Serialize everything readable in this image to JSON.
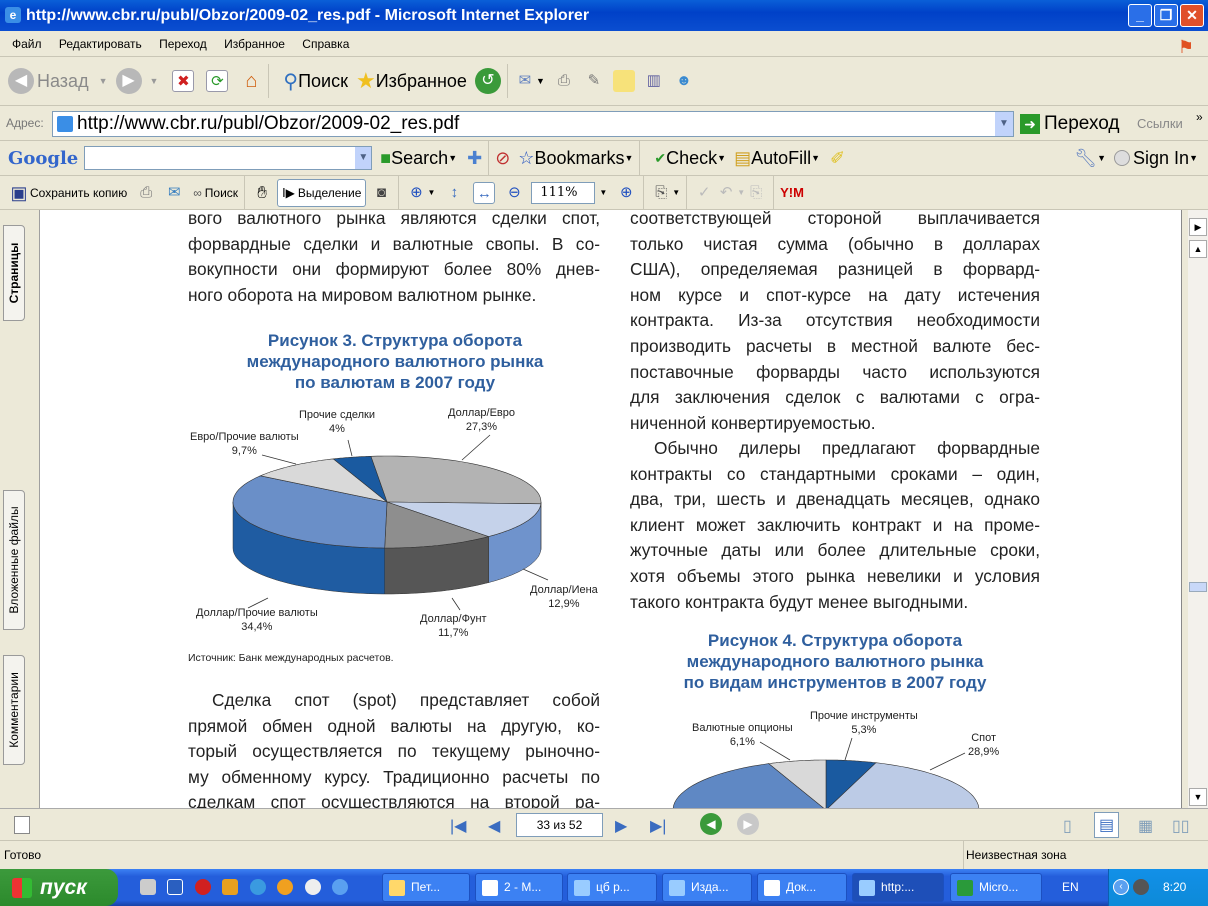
{
  "window": {
    "title": "http://www.cbr.ru/publ/Obzor/2009-02_res.pdf - Microsoft Internet Explorer"
  },
  "menu": [
    "Файл",
    "Редактировать",
    "Переход",
    "Избранное",
    "Справка"
  ],
  "toolbar": {
    "back": "Назад",
    "search": "Поиск",
    "favorites": "Избранное"
  },
  "address": {
    "label": "Адрес:",
    "url": "http://www.cbr.ru/publ/Obzor/2009-02_res.pdf",
    "go": "Переход",
    "links": "Ссылки"
  },
  "google": {
    "logo": "Google",
    "search_value": "",
    "search": "Search",
    "bookmarks": "Bookmarks",
    "check": "Check",
    "autofill": "AutoFill",
    "signin": "Sign In"
  },
  "adobe": {
    "save_copy": "Сохранить копию",
    "search": "Поиск",
    "select": "Выделение",
    "zoom": "111%"
  },
  "side_tabs": {
    "pages": "Страницы",
    "attachments": "Вложенные файлы",
    "comments": "Комментарии"
  },
  "doc": {
    "left_top": [
      "вого валютного рынка являются сделки спот,",
      "форвардные сделки и валютные свопы. В со-",
      "вокупности они формируют более 80% днев-",
      "ного оборота на мировом валютном рынке."
    ],
    "fig3_caption": [
      "Рисунок 3. Структура оборота",
      "международного валютного рынка",
      "по валютам в 2007 году"
    ],
    "fig3_source": "Источник: Банк международных расчетов.",
    "left_bottom": [
      "Сделка спот (spot) представляет собой",
      "прямой обмен одной валюты на другую, ко-",
      "торый осуществляется по текущему рыночно-",
      "му обменному курсу. Традиционно расчеты по",
      "сделкам спот осуществляются на второй ра-"
    ],
    "right_p1": [
      "соответствующей стороной выплачивается",
      "только чистая сумма (обычно в долларах",
      "США), определяемая разницей в форвард-",
      "ном курсе и спот-курсе на дату истечения",
      "контракта. Из-за отсутствия необходимости",
      "производить расчеты в местной валюте бес-",
      "поставочные форварды часто используются",
      "для заключения сделок с валютами с огра-",
      "ниченной конвертируемостью."
    ],
    "right_p2": [
      "Обычно дилеры предлагают форвардные",
      "контракты со стандартными сроками – один,",
      "два, три, шесть и двенадцать месяцев, однако",
      "клиент может заключить контракт и на проме-",
      "жуточные даты или более длительные сроки,",
      "хотя объемы этого рынка невелики и условия",
      "такого контракта будут менее выгодными."
    ],
    "fig4_caption": [
      "Рисунок 4. Структура оборота",
      "международного валютного рынка",
      "по видам инструментов в 2007 году"
    ]
  },
  "chart_data": [
    {
      "type": "pie",
      "title": "Рисунок 3. Структура оборота международного валютного рынка по валютам в 2007 году",
      "slices": [
        {
          "label": "Доллар/Евро",
          "value": 27.3,
          "top": "#b3b3b3",
          "side": "#8a8a8a"
        },
        {
          "label": "Доллар/Иена",
          "value": 12.9,
          "top": "#c5d2ea",
          "side": "#6f93cc"
        },
        {
          "label": "Доллар/Фунт",
          "value": 11.7,
          "top": "#8e8e8e",
          "side": "#565656"
        },
        {
          "label": "Доллар/Прочие валюты",
          "value": 34.4,
          "top": "#6a8fc8",
          "side": "#1f5ca2"
        },
        {
          "label": "Евро/Прочие валюты",
          "value": 9.7,
          "top": "#d9d9d9",
          "side": "#a9a9a9"
        },
        {
          "label": "Прочие сделки",
          "value": 4,
          "top": "#1a5aa0",
          "side": "#0f3f78"
        }
      ]
    },
    {
      "type": "pie",
      "title": "Рисунок 4. Структура оборота международного валютного рынка по видам инструментов в 2007 году",
      "slices": [
        {
          "label": "Прочие инструменты",
          "value": 5.3,
          "top": "#1a5aa0"
        },
        {
          "label": "Спот",
          "value": 28.9,
          "top": "#bccbe6"
        },
        {
          "label": "Валютные опционы",
          "value": 6.1,
          "top": "#d9d9d9"
        }
      ]
    }
  ],
  "nav": {
    "page": "33 из 52"
  },
  "status": {
    "left": "Готово",
    "zone": "Неизвестная зона"
  },
  "taskbar": {
    "start": "пуск",
    "tasks": [
      "Пет...",
      "2 - M...",
      "цб р...",
      "Изда...",
      "Док...",
      "http:...",
      "Micro..."
    ],
    "lang": "EN",
    "time": "8:20"
  }
}
